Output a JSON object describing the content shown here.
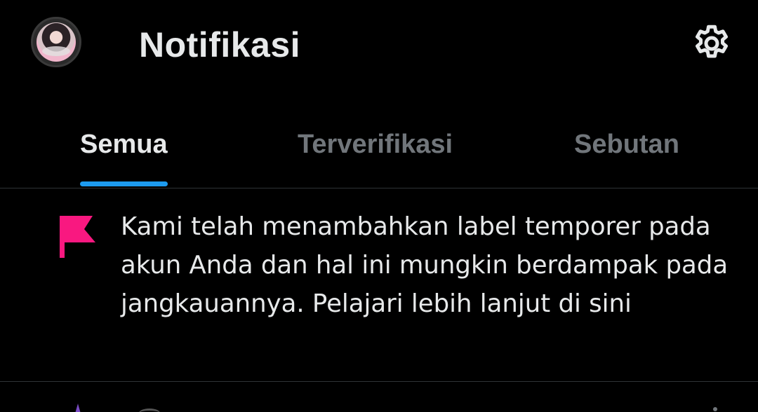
{
  "header": {
    "title": "Notifikasi",
    "avatar_icon": "profile-avatar",
    "settings_icon": "gear-icon"
  },
  "tabs": [
    {
      "label": "Semua",
      "active": true
    },
    {
      "label": "Terverifikasi",
      "active": false
    },
    {
      "label": "Sebutan",
      "active": false
    }
  ],
  "notice": {
    "icon": "flag-icon",
    "icon_color": "#f91880",
    "text": "Kami telah menambahkan label temporer pada akun Anda dan hal ini mungkin berdampak pada jangkauannya. Pelajari lebih lanjut di sini"
  },
  "colors": {
    "background": "#000000",
    "accent": "#1d9bf0",
    "text_primary": "#e7e9ea",
    "text_secondary": "#71767b",
    "divider": "#2f3336",
    "peek_star": "#794bc4"
  }
}
